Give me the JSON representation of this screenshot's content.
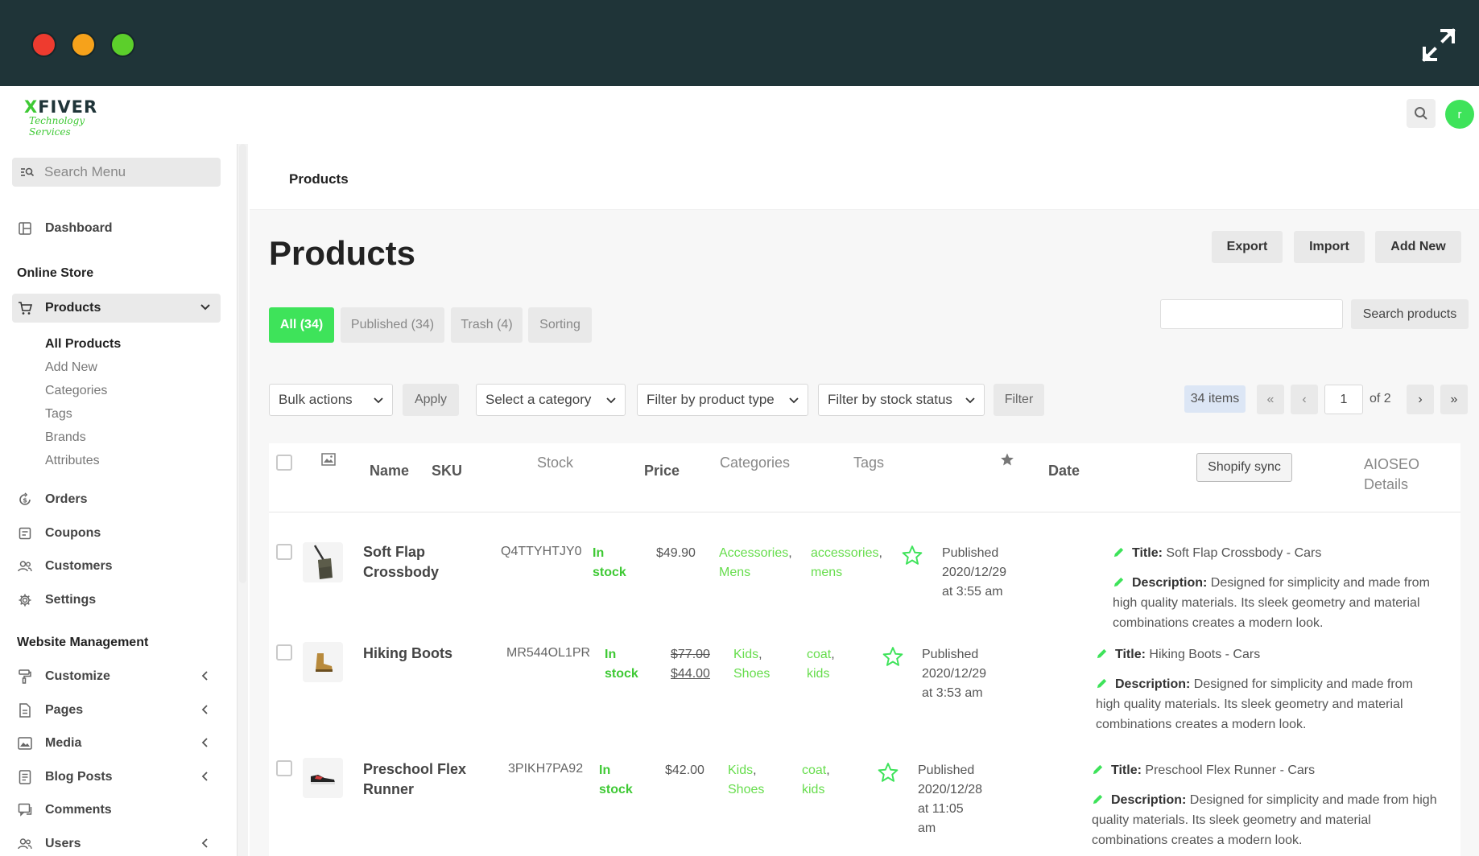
{
  "topbar": {
    "logo_main": "FIVER",
    "logo_x": "X",
    "logo_sub": "Technology Services",
    "avatar_letter": "r"
  },
  "sidebar": {
    "search_placeholder": "Search Menu",
    "dashboard": "Dashboard",
    "section_online_store": "Online Store",
    "products": "Products",
    "sub_items": [
      "All Products",
      "Add New",
      "Categories",
      "Tags",
      "Brands",
      "Attributes"
    ],
    "orders": "Orders",
    "coupons": "Coupons",
    "customers": "Customers",
    "settings": "Settings",
    "section_website": "Website Management",
    "customize": "Customize",
    "pages": "Pages",
    "media": "Media",
    "blog_posts": "Blog Posts",
    "comments": "Comments",
    "users": "Users"
  },
  "breadcrumb": "Products",
  "page": {
    "title": "Products",
    "export": "Export",
    "import": "Import",
    "add_new": "Add New",
    "tabs": [
      "All (34)",
      "Published (34)",
      "Trash (4)",
      "Sorting"
    ],
    "search_btn": "Search products",
    "bulk_actions": "Bulk actions",
    "apply": "Apply",
    "select_category": "Select a category",
    "filter_type": "Filter by product type",
    "filter_stock": "Filter by stock status",
    "filter": "Filter",
    "items": "34 items",
    "pager_first": "«",
    "pager_prev": "‹",
    "pager_current": "1",
    "pager_of": "of 2",
    "pager_next": "›",
    "pager_last": "»"
  },
  "table": {
    "headers": {
      "name": "Name",
      "sku": "SKU",
      "stock": "Stock",
      "price": "Price",
      "categories": "Categories",
      "tags": "Tags",
      "date": "Date",
      "shopify": "Shopify sync",
      "aioseo_1": "AIOSEO",
      "aioseo_2": "Details"
    },
    "rows": [
      {
        "name_1": "Soft Flap",
        "name_2": "Crossbody",
        "sku": "Q4TTYHTJY0",
        "stock_1": "In",
        "stock_2": "stock",
        "price": "$49.90",
        "cat_1": "Accessories",
        "cat_2": "Mens",
        "tag_1": "accessories",
        "tag_2": "mens",
        "date_1": "Published",
        "date_2": "2020/12/29",
        "date_3": "at 3:55 am",
        "seo_title_label": "Title:",
        "seo_title": "Soft Flap Crossbody - Cars",
        "seo_desc_label": "Description:",
        "seo_desc_1": "Designed for simplicity and made from",
        "seo_desc_2": "high quality materials. Its sleek geometry and material",
        "seo_desc_3": "combinations creates a modern look."
      },
      {
        "name_1": "Hiking Boots",
        "sku": "MR544OL1PR",
        "stock_1": "In",
        "stock_2": "stock",
        "price_old": "$77.00",
        "price_new": "$44.00",
        "cat_1": "Kids",
        "cat_2": "Shoes",
        "tag_1": "coat",
        "tag_2": "kids",
        "date_1": "Published",
        "date_2": "2020/12/29",
        "date_3": "at 3:53 am",
        "seo_title_label": "Title:",
        "seo_title": "Hiking Boots - Cars",
        "seo_desc_label": "Description:",
        "seo_desc_1": "Designed for simplicity and made from",
        "seo_desc_2": "high quality materials. Its sleek geometry and material",
        "seo_desc_3": "combinations creates a modern look."
      },
      {
        "name_1": "Preschool Flex",
        "name_2": "Runner",
        "sku": "3PIKH7PA92",
        "stock_1": "In",
        "stock_2": "stock",
        "price": "$42.00",
        "cat_1": "Kids",
        "cat_2": "Shoes",
        "tag_1": "coat",
        "tag_2": "kids",
        "date_1": "Published",
        "date_2": "2020/12/28",
        "date_3": "at 11:05",
        "date_4": "am",
        "seo_title_label": "Title:",
        "seo_title": "Preschool Flex Runner - Cars",
        "seo_desc_label": "Description:",
        "seo_desc_1": "Designed for simplicity and made from high",
        "seo_desc_2": "quality materials. Its sleek geometry and material",
        "seo_desc_3": "combinations creates a modern look."
      }
    ]
  },
  "colors": {
    "accent": "#3ee35a",
    "titlebar": "#1f3438",
    "link_green": "#66dd4c"
  }
}
